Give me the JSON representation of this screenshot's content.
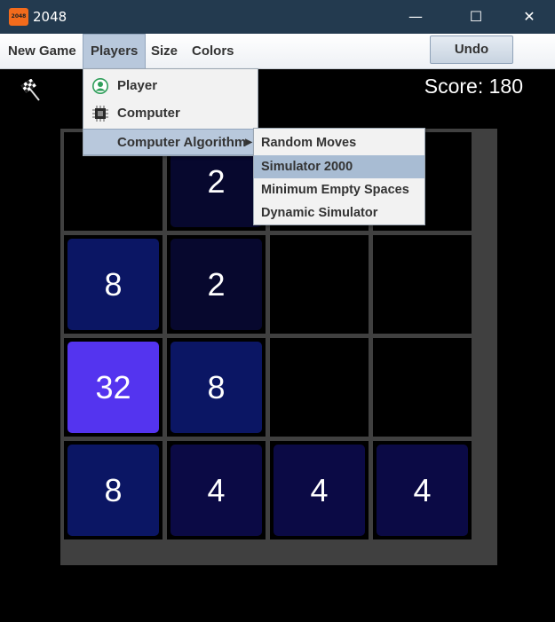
{
  "window": {
    "app_icon_text": "2048",
    "title": "2048",
    "minimize_glyph": "—",
    "maximize_glyph": "☐",
    "close_glyph": "✕"
  },
  "menubar": {
    "items": [
      "New Game",
      "Players",
      "Size",
      "Colors"
    ],
    "active": "Players",
    "undo_label": "Undo"
  },
  "players_menu": {
    "items": [
      {
        "label": "Player",
        "icon": "user-icon"
      },
      {
        "label": "Computer",
        "icon": "cpu-icon"
      },
      {
        "label": "Computer Algorithm",
        "icon": "",
        "has_submenu": true
      }
    ],
    "highlighted": "Computer Algorithm"
  },
  "algorithm_submenu": {
    "items": [
      "Random Moves",
      "Simulator 2000",
      "Minimum Empty Spaces",
      "Dynamic Simulator"
    ],
    "highlighted": "Simulator 2000"
  },
  "game": {
    "score_text": "Score: 180",
    "board_size": 4,
    "grid": [
      [
        null,
        2,
        null,
        null
      ],
      [
        8,
        2,
        null,
        null
      ],
      [
        32,
        8,
        null,
        null
      ],
      [
        8,
        4,
        4,
        4
      ]
    ],
    "tile_colors": {
      "2": "#07082e",
      "4": "#0b0a45",
      "8": "#0b1664",
      "32": "#5434ef"
    },
    "board_border_color": "#404040"
  }
}
